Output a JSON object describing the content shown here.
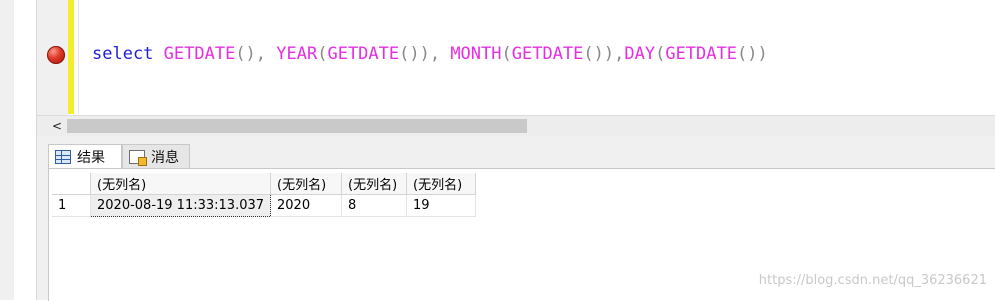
{
  "editor": {
    "tokens": [
      {
        "text": "select ",
        "type": "kw"
      },
      {
        "text": "GETDATE",
        "type": "fn"
      },
      {
        "text": "(), ",
        "type": "pn"
      },
      {
        "text": "YEAR",
        "type": "fn"
      },
      {
        "text": "(",
        "type": "pn"
      },
      {
        "text": "GETDATE",
        "type": "fn"
      },
      {
        "text": "()), ",
        "type": "pn"
      },
      {
        "text": "MONTH",
        "type": "fn"
      },
      {
        "text": "(",
        "type": "pn"
      },
      {
        "text": "GETDATE",
        "type": "fn"
      },
      {
        "text": "()),",
        "type": "pn"
      },
      {
        "text": "DAY",
        "type": "fn"
      },
      {
        "text": "(",
        "type": "pn"
      },
      {
        "text": "GETDATE",
        "type": "fn"
      },
      {
        "text": "())",
        "type": "pn"
      }
    ],
    "colors": {
      "keyword": "#1f1fd6",
      "function": "#e62ee3",
      "punctuation": "#888888",
      "change_bar": "#f2ef2a"
    }
  },
  "scrollbar": {
    "left_arrow": "<"
  },
  "tabs": {
    "results": {
      "label": "结果",
      "icon": "grid-icon"
    },
    "messages": {
      "label": "消息",
      "icon": "message-icon"
    }
  },
  "grid": {
    "headers": [
      "(无列名)",
      "(无列名)",
      "(无列名)",
      "(无列名)"
    ],
    "rows": [
      {
        "num": "1",
        "cells": [
          "2020-08-19 11:33:13.037",
          "2020",
          "8",
          "19"
        ]
      }
    ]
  },
  "watermark": "https://blog.csdn.net/qq_36236621"
}
